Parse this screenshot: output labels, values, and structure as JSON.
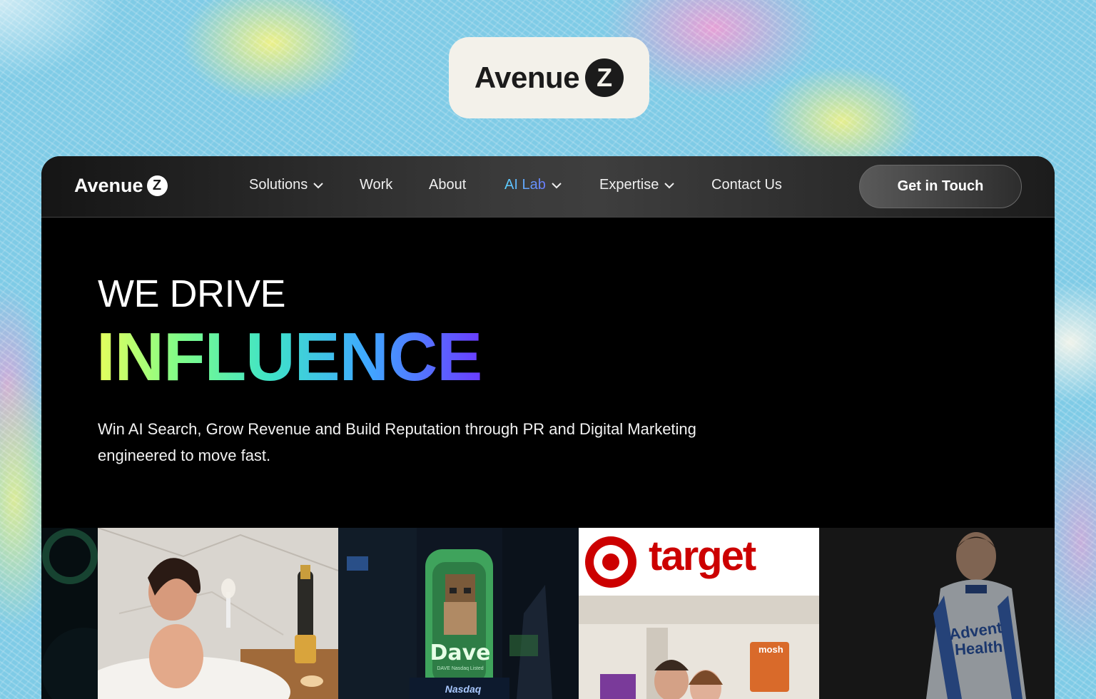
{
  "brand": {
    "name": "Avenue",
    "badge_letter": "Z"
  },
  "nav": {
    "items": [
      {
        "label": "Solutions",
        "has_dropdown": true
      },
      {
        "label": "Work",
        "has_dropdown": false
      },
      {
        "label": "About",
        "has_dropdown": false
      },
      {
        "label": "AI Lab",
        "has_dropdown": true
      },
      {
        "label": "Expertise",
        "has_dropdown": true
      },
      {
        "label": "Contact Us",
        "has_dropdown": false
      }
    ],
    "cta_label": "Get in Touch"
  },
  "hero": {
    "kicker": "WE DRIVE",
    "title": "INFLUENCE",
    "subtitle_line1": "Win AI Search, Grow Revenue and Build Reputation through PR and Digital Marketing",
    "subtitle_line2": "engineered to move fast."
  },
  "tiles": {
    "billboard_text": "Dave",
    "billboard_sub": "DAVE   Nasdaq Listed",
    "nasdaq": "Nasdaq",
    "store_sign": "target",
    "product_label": "mosh",
    "suit_text_1": "Advent",
    "suit_text_2": "Health"
  },
  "colors": {
    "background": "#7fcbe6",
    "frame": "#000000",
    "influence_gradient": [
      "#e7ff5c",
      "#7dfc8a",
      "#3fe3c8",
      "#3fa9ff",
      "#6a3cff"
    ],
    "ai_lab_gradient": [
      "#5cd2ff",
      "#6b7cff"
    ]
  }
}
